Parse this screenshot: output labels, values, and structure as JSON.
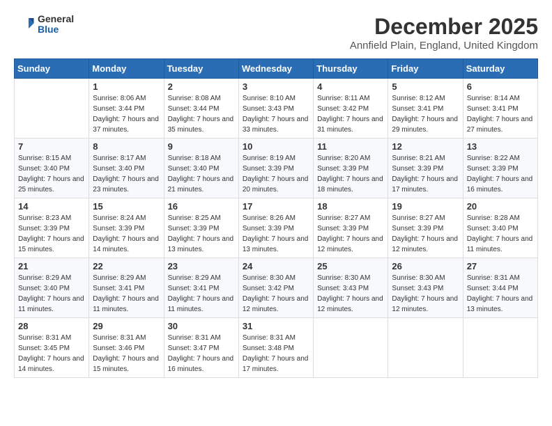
{
  "header": {
    "logo_general": "General",
    "logo_blue": "Blue",
    "title": "December 2025",
    "location": "Annfield Plain, England, United Kingdom"
  },
  "weekdays": [
    "Sunday",
    "Monday",
    "Tuesday",
    "Wednesday",
    "Thursday",
    "Friday",
    "Saturday"
  ],
  "weeks": [
    [
      {
        "day": "",
        "sunrise": "",
        "sunset": "",
        "daylight": ""
      },
      {
        "day": "1",
        "sunrise": "Sunrise: 8:06 AM",
        "sunset": "Sunset: 3:44 PM",
        "daylight": "Daylight: 7 hours and 37 minutes."
      },
      {
        "day": "2",
        "sunrise": "Sunrise: 8:08 AM",
        "sunset": "Sunset: 3:44 PM",
        "daylight": "Daylight: 7 hours and 35 minutes."
      },
      {
        "day": "3",
        "sunrise": "Sunrise: 8:10 AM",
        "sunset": "Sunset: 3:43 PM",
        "daylight": "Daylight: 7 hours and 33 minutes."
      },
      {
        "day": "4",
        "sunrise": "Sunrise: 8:11 AM",
        "sunset": "Sunset: 3:42 PM",
        "daylight": "Daylight: 7 hours and 31 minutes."
      },
      {
        "day": "5",
        "sunrise": "Sunrise: 8:12 AM",
        "sunset": "Sunset: 3:41 PM",
        "daylight": "Daylight: 7 hours and 29 minutes."
      },
      {
        "day": "6",
        "sunrise": "Sunrise: 8:14 AM",
        "sunset": "Sunset: 3:41 PM",
        "daylight": "Daylight: 7 hours and 27 minutes."
      }
    ],
    [
      {
        "day": "7",
        "sunrise": "Sunrise: 8:15 AM",
        "sunset": "Sunset: 3:40 PM",
        "daylight": "Daylight: 7 hours and 25 minutes."
      },
      {
        "day": "8",
        "sunrise": "Sunrise: 8:17 AM",
        "sunset": "Sunset: 3:40 PM",
        "daylight": "Daylight: 7 hours and 23 minutes."
      },
      {
        "day": "9",
        "sunrise": "Sunrise: 8:18 AM",
        "sunset": "Sunset: 3:40 PM",
        "daylight": "Daylight: 7 hours and 21 minutes."
      },
      {
        "day": "10",
        "sunrise": "Sunrise: 8:19 AM",
        "sunset": "Sunset: 3:39 PM",
        "daylight": "Daylight: 7 hours and 20 minutes."
      },
      {
        "day": "11",
        "sunrise": "Sunrise: 8:20 AM",
        "sunset": "Sunset: 3:39 PM",
        "daylight": "Daylight: 7 hours and 18 minutes."
      },
      {
        "day": "12",
        "sunrise": "Sunrise: 8:21 AM",
        "sunset": "Sunset: 3:39 PM",
        "daylight": "Daylight: 7 hours and 17 minutes."
      },
      {
        "day": "13",
        "sunrise": "Sunrise: 8:22 AM",
        "sunset": "Sunset: 3:39 PM",
        "daylight": "Daylight: 7 hours and 16 minutes."
      }
    ],
    [
      {
        "day": "14",
        "sunrise": "Sunrise: 8:23 AM",
        "sunset": "Sunset: 3:39 PM",
        "daylight": "Daylight: 7 hours and 15 minutes."
      },
      {
        "day": "15",
        "sunrise": "Sunrise: 8:24 AM",
        "sunset": "Sunset: 3:39 PM",
        "daylight": "Daylight: 7 hours and 14 minutes."
      },
      {
        "day": "16",
        "sunrise": "Sunrise: 8:25 AM",
        "sunset": "Sunset: 3:39 PM",
        "daylight": "Daylight: 7 hours and 13 minutes."
      },
      {
        "day": "17",
        "sunrise": "Sunrise: 8:26 AM",
        "sunset": "Sunset: 3:39 PM",
        "daylight": "Daylight: 7 hours and 13 minutes."
      },
      {
        "day": "18",
        "sunrise": "Sunrise: 8:27 AM",
        "sunset": "Sunset: 3:39 PM",
        "daylight": "Daylight: 7 hours and 12 minutes."
      },
      {
        "day": "19",
        "sunrise": "Sunrise: 8:27 AM",
        "sunset": "Sunset: 3:39 PM",
        "daylight": "Daylight: 7 hours and 12 minutes."
      },
      {
        "day": "20",
        "sunrise": "Sunrise: 8:28 AM",
        "sunset": "Sunset: 3:40 PM",
        "daylight": "Daylight: 7 hours and 11 minutes."
      }
    ],
    [
      {
        "day": "21",
        "sunrise": "Sunrise: 8:29 AM",
        "sunset": "Sunset: 3:40 PM",
        "daylight": "Daylight: 7 hours and 11 minutes."
      },
      {
        "day": "22",
        "sunrise": "Sunrise: 8:29 AM",
        "sunset": "Sunset: 3:41 PM",
        "daylight": "Daylight: 7 hours and 11 minutes."
      },
      {
        "day": "23",
        "sunrise": "Sunrise: 8:29 AM",
        "sunset": "Sunset: 3:41 PM",
        "daylight": "Daylight: 7 hours and 11 minutes."
      },
      {
        "day": "24",
        "sunrise": "Sunrise: 8:30 AM",
        "sunset": "Sunset: 3:42 PM",
        "daylight": "Daylight: 7 hours and 12 minutes."
      },
      {
        "day": "25",
        "sunrise": "Sunrise: 8:30 AM",
        "sunset": "Sunset: 3:43 PM",
        "daylight": "Daylight: 7 hours and 12 minutes."
      },
      {
        "day": "26",
        "sunrise": "Sunrise: 8:30 AM",
        "sunset": "Sunset: 3:43 PM",
        "daylight": "Daylight: 7 hours and 12 minutes."
      },
      {
        "day": "27",
        "sunrise": "Sunrise: 8:31 AM",
        "sunset": "Sunset: 3:44 PM",
        "daylight": "Daylight: 7 hours and 13 minutes."
      }
    ],
    [
      {
        "day": "28",
        "sunrise": "Sunrise: 8:31 AM",
        "sunset": "Sunset: 3:45 PM",
        "daylight": "Daylight: 7 hours and 14 minutes."
      },
      {
        "day": "29",
        "sunrise": "Sunrise: 8:31 AM",
        "sunset": "Sunset: 3:46 PM",
        "daylight": "Daylight: 7 hours and 15 minutes."
      },
      {
        "day": "30",
        "sunrise": "Sunrise: 8:31 AM",
        "sunset": "Sunset: 3:47 PM",
        "daylight": "Daylight: 7 hours and 16 minutes."
      },
      {
        "day": "31",
        "sunrise": "Sunrise: 8:31 AM",
        "sunset": "Sunset: 3:48 PM",
        "daylight": "Daylight: 7 hours and 17 minutes."
      },
      {
        "day": "",
        "sunrise": "",
        "sunset": "",
        "daylight": ""
      },
      {
        "day": "",
        "sunrise": "",
        "sunset": "",
        "daylight": ""
      },
      {
        "day": "",
        "sunrise": "",
        "sunset": "",
        "daylight": ""
      }
    ]
  ]
}
